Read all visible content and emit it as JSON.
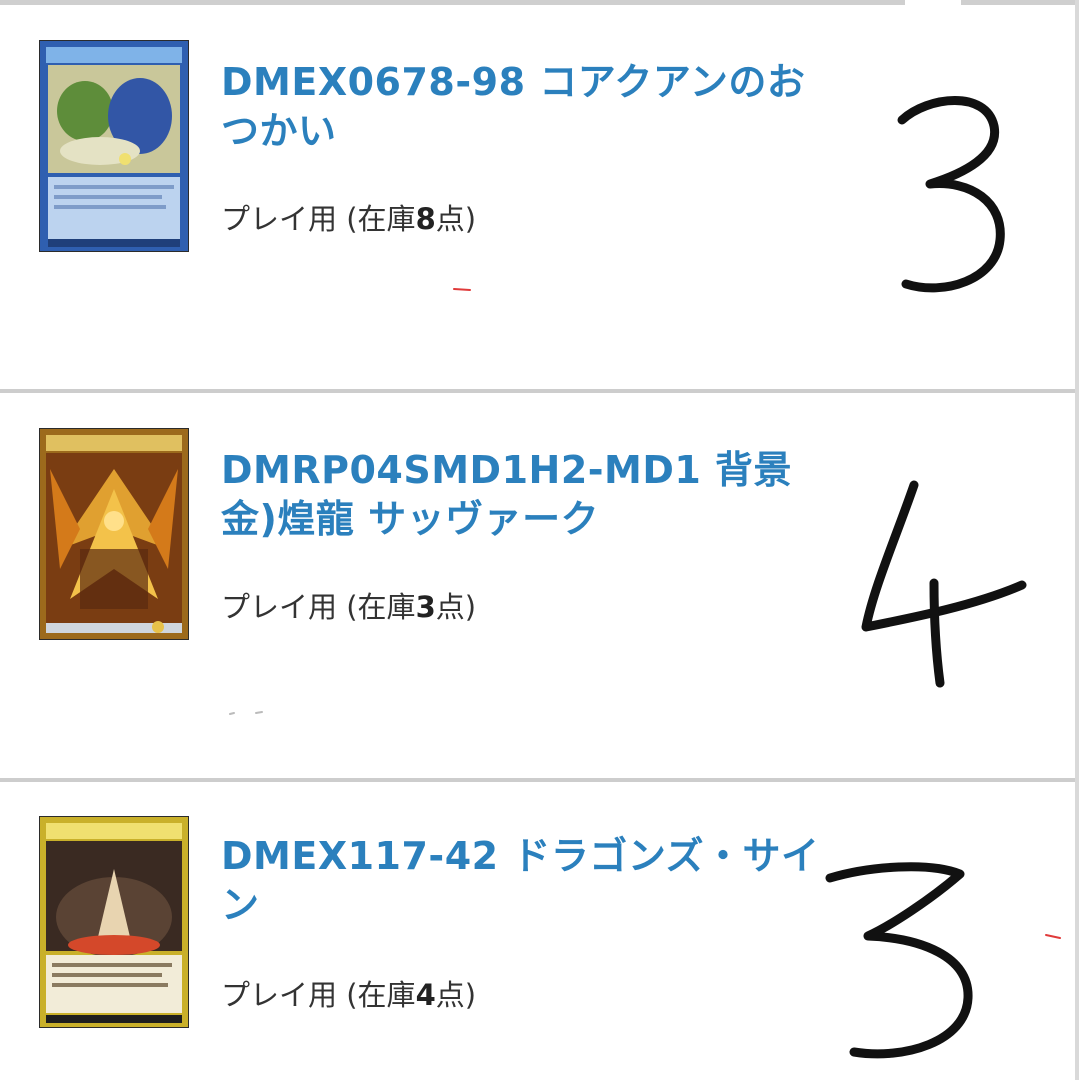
{
  "items": [
    {
      "title": "DMEX0678-98 コアクアンのおつかい",
      "condition": "プレイ用",
      "stock_open": " (在庫",
      "stock_count": "8",
      "stock_close": "点)",
      "handwritten_qty": "3",
      "card_color": "#3d6fc4"
    },
    {
      "title": "DMRP04SMD1H2-MD1 背景金)煌龍 サッヴァーク",
      "condition": "プレイ用",
      "stock_open": " (在庫",
      "stock_count": "3",
      "stock_close": "点)",
      "handwritten_qty": "4",
      "card_color": "#c9871f"
    },
    {
      "title": "DMEX117-42 ドラゴンズ・サイン",
      "condition": "プレイ用",
      "stock_open": " (在庫",
      "stock_count": "4",
      "stock_close": "点)",
      "handwritten_qty": "3",
      "card_color": "#d9c23a"
    }
  ],
  "colors": {
    "link": "#2b80bd",
    "text": "#333333",
    "separator": "#cdcdcd",
    "ink": "#111111"
  }
}
